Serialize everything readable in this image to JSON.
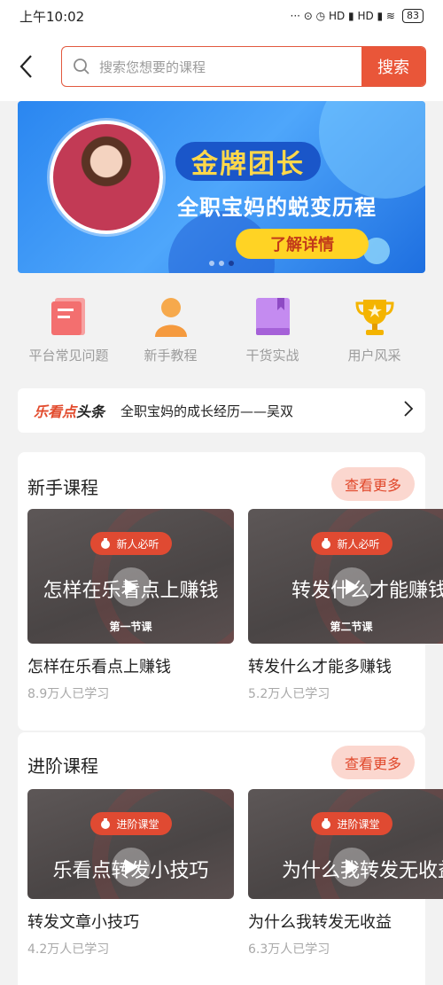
{
  "status": {
    "time": "上午10:02",
    "icons": "··· ⊙ ◷ HD ▮ HD ▮ ≋",
    "battery": "83"
  },
  "search": {
    "placeholder": "搜索您想要的课程",
    "button": "搜索"
  },
  "banner": {
    "badge": "金牌团长",
    "subtitle": "全职宝妈的蜕变历程",
    "cta": "了解详情"
  },
  "categories": [
    {
      "label": "平台常见问题",
      "icon": "document-icon",
      "color": "#f36f6f"
    },
    {
      "label": "新手教程",
      "icon": "person-icon",
      "color": "#f59a3e"
    },
    {
      "label": "干货实战",
      "icon": "book-icon",
      "color": "#b56be6"
    },
    {
      "label": "用户风采",
      "icon": "trophy-icon",
      "color": "#f4b400"
    }
  ],
  "ticker": {
    "brand_a": "乐看点",
    "brand_b": "头条",
    "text": "全职宝妈的成长经历——吴双"
  },
  "sections": [
    {
      "title": "新手课程",
      "more": "查看更多",
      "cards": [
        {
          "pill": "新人必听",
          "thumb_title": "怎样在乐看点上赚钱",
          "lesson": "第一节课",
          "title": "怎样在乐看点上赚钱",
          "meta": "8.9万人已学习"
        },
        {
          "pill": "新人必听",
          "thumb_title": "转发什么才能赚钱",
          "lesson": "第二节课",
          "title": "转发什么才能多赚钱",
          "meta": "5.2万人已学习"
        }
      ]
    },
    {
      "title": "进阶课程",
      "more": "查看更多",
      "cards": [
        {
          "pill": "进阶课堂",
          "thumb_title": "乐看点转发小技巧",
          "lesson": "",
          "title": "转发文章小技巧",
          "meta": "4.2万人已学习"
        },
        {
          "pill": "进阶课堂",
          "thumb_title": "为什么我转发无收益",
          "lesson": "",
          "title": "为什么我转发无收益",
          "meta": "6.3万人已学习"
        }
      ]
    }
  ],
  "colors": {
    "accent": "#e95639",
    "more_bg": "#fbd7cf",
    "banner_blue": "#2a86f0"
  }
}
